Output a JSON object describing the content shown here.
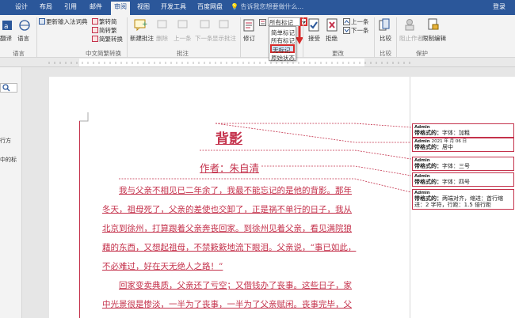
{
  "tabs": [
    "设计",
    "布局",
    "引用",
    "邮件",
    "审阅",
    "视图",
    "开发工具",
    "百度网盘"
  ],
  "tell_me": "告诉我您想要做什么...",
  "login": "登录",
  "ribbon": {
    "ime_dict": "更新输入法词典",
    "trad_to_simp": "繁转简",
    "simp_to_trad": "简转繁",
    "simp_trad_convert": "简繁转换",
    "translate": "翻译",
    "language": "语言",
    "new_comment": "新建批注",
    "delete": "删除",
    "previous": "上一条",
    "next": "下一条",
    "show_comments": "显示批注",
    "track_changes": "修订",
    "display_markup": "所有标记",
    "accept": "接受",
    "reject": "拒绝",
    "prev_change": "上一条",
    "next_change": "下一条",
    "compare": "比较",
    "block_authors": "阻止作者",
    "restrict_editing": "限制编辑"
  },
  "groups": {
    "language": "语言",
    "chinese_conversion": "中文简繁转换",
    "comments": "批注",
    "tracking": "修订",
    "changes": "更改",
    "compare": "比较",
    "protect": "保护"
  },
  "dropdown": {
    "options": [
      "简单标记",
      "所有标记",
      "无标记",
      "原始状态"
    ]
  },
  "nav": {
    "line1": "行方",
    "line2": "中的标"
  },
  "document": {
    "title": "背影",
    "author": "作者：朱自清",
    "paragraphs": [
      "我与父亲不相见已二年余了，我最不能忘记的是他的背影。那年",
      "冬天，祖母死了，父亲的差使也交卸了，正是祸不单行的日子，我从",
      "北京到徐州，打算跟着父亲奔丧回家。到徐州见着父亲，看见满院狼",
      "藉的东西，又想起祖母，不禁簌簌地流下眼泪。父亲说，“事已如此，",
      "不必难过，好在天无绝人之路！”",
      "回家变卖典质，父亲还了亏空；又借钱办了丧事。这些日子，家",
      "中光景很是惨淡，一半为了丧事，一半为了父亲赋闲。丧事完毕，父"
    ]
  },
  "balloons": [
    {
      "author": "Admin",
      "label": "带格式的：",
      "text": "字体：加粗"
    },
    {
      "author": "Admin",
      "label": "带格式的：",
      "text": "居中",
      "date": "2021 年 月 06 日"
    },
    {
      "author": "Admin",
      "label": "带格式的：",
      "text": "字体：三号"
    },
    {
      "author": "Admin",
      "label": "带格式的：",
      "text": "字体：四号"
    },
    {
      "author": "Admin",
      "label": "带格式的：",
      "text": "两端对齐，缩进：首行缩进：2 字符，行距：1.5 倍行距"
    }
  ],
  "colors": {
    "accent": "#2b579a",
    "revision": "#c4314b"
  }
}
